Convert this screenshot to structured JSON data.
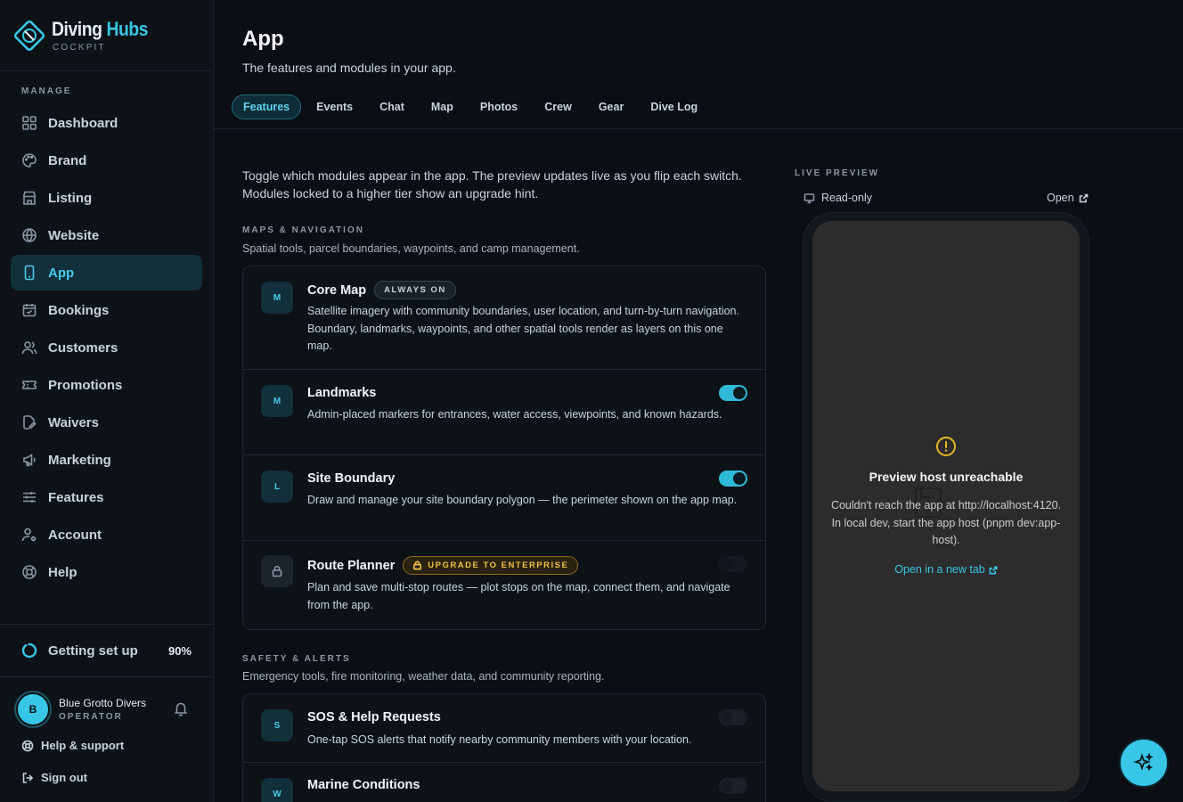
{
  "brand": {
    "name_part1": "Diving",
    "name_part2": "Hubs",
    "subtitle": "COCKPIT"
  },
  "sidebar": {
    "section_label": "MANAGE",
    "items": [
      {
        "label": "Dashboard",
        "icon": "grid-icon"
      },
      {
        "label": "Brand",
        "icon": "palette-icon"
      },
      {
        "label": "Listing",
        "icon": "store-icon"
      },
      {
        "label": "Website",
        "icon": "globe-icon"
      },
      {
        "label": "App",
        "icon": "phone-icon",
        "active": true
      },
      {
        "label": "Bookings",
        "icon": "calendar-icon"
      },
      {
        "label": "Customers",
        "icon": "users-icon"
      },
      {
        "label": "Promotions",
        "icon": "ticket-icon"
      },
      {
        "label": "Waivers",
        "icon": "document-pen-icon"
      },
      {
        "label": "Marketing",
        "icon": "megaphone-icon"
      },
      {
        "label": "Features",
        "icon": "sliders-icon"
      },
      {
        "label": "Account",
        "icon": "user-gear-icon"
      },
      {
        "label": "Help",
        "icon": "lifebuoy-icon"
      }
    ],
    "setup": {
      "label": "Getting set up",
      "percent": "90%",
      "progress": 0.9
    },
    "user": {
      "initial": "B",
      "name": "Blue Grotto Divers",
      "role": "OPERATOR"
    },
    "help_support": "Help & support",
    "sign_out": "Sign out"
  },
  "header": {
    "title": "App",
    "subtitle": "The features and modules in your app.",
    "tabs": [
      "Features",
      "Events",
      "Chat",
      "Map",
      "Photos",
      "Crew",
      "Gear",
      "Dive Log"
    ],
    "active_tab": "Features"
  },
  "main": {
    "intro_line1": "Toggle which modules appear in the app. The preview updates live as you flip each switch.",
    "intro_line2": "Modules locked to a higher tier show an upgrade hint.",
    "categories": [
      {
        "label": "MAPS & NAVIGATION",
        "description": "Spatial tools, parcel boundaries, waypoints, and camp management.",
        "features": [
          {
            "badge": "M",
            "title": "Core Map",
            "pill": "ALWAYS ON",
            "description": "Satellite imagery with community boundaries, user location, and turn-by-turn navigation. Boundary, landmarks, waypoints, and other spatial tools render as layers on this one map."
          },
          {
            "badge": "M",
            "title": "Landmarks",
            "enabled": true,
            "description": "Admin-placed markers for entrances, water access, viewpoints, and known hazards."
          },
          {
            "badge": "L",
            "title": "Site Boundary",
            "enabled": true,
            "description": "Draw and manage your site boundary polygon — the perimeter shown on the app map."
          },
          {
            "badge": "lock-icon",
            "title": "Route Planner",
            "pill": "UPGRADE TO ENTERPRISE",
            "enabled": false,
            "description": "Plan and save multi-stop routes — plot stops on the map, connect them, and navigate from the app."
          }
        ]
      },
      {
        "label": "SAFETY & ALERTS",
        "description": "Emergency tools, fire monitoring, weather data, and community reporting.",
        "features": [
          {
            "badge": "S",
            "title": "SOS & Help Requests",
            "enabled": false,
            "description": "One-tap SOS alerts that notify nearby community members with your location."
          },
          {
            "badge": "W",
            "title": "Marine Conditions",
            "enabled": false
          }
        ]
      }
    ]
  },
  "preview": {
    "label": "LIVE PREVIEW",
    "read_only": "Read-only",
    "open": "Open",
    "error_title": "Preview host unreachable",
    "error_body": "Couldn't reach the app at http://localhost:4120. In local dev, start the app host (pnpm dev:app-host).",
    "error_link": "Open in a new tab"
  },
  "colors": {
    "accent": "#38c6e6",
    "background": "#0b0f14",
    "upgrade": "#f1c14a",
    "warning": "#e8b923"
  }
}
